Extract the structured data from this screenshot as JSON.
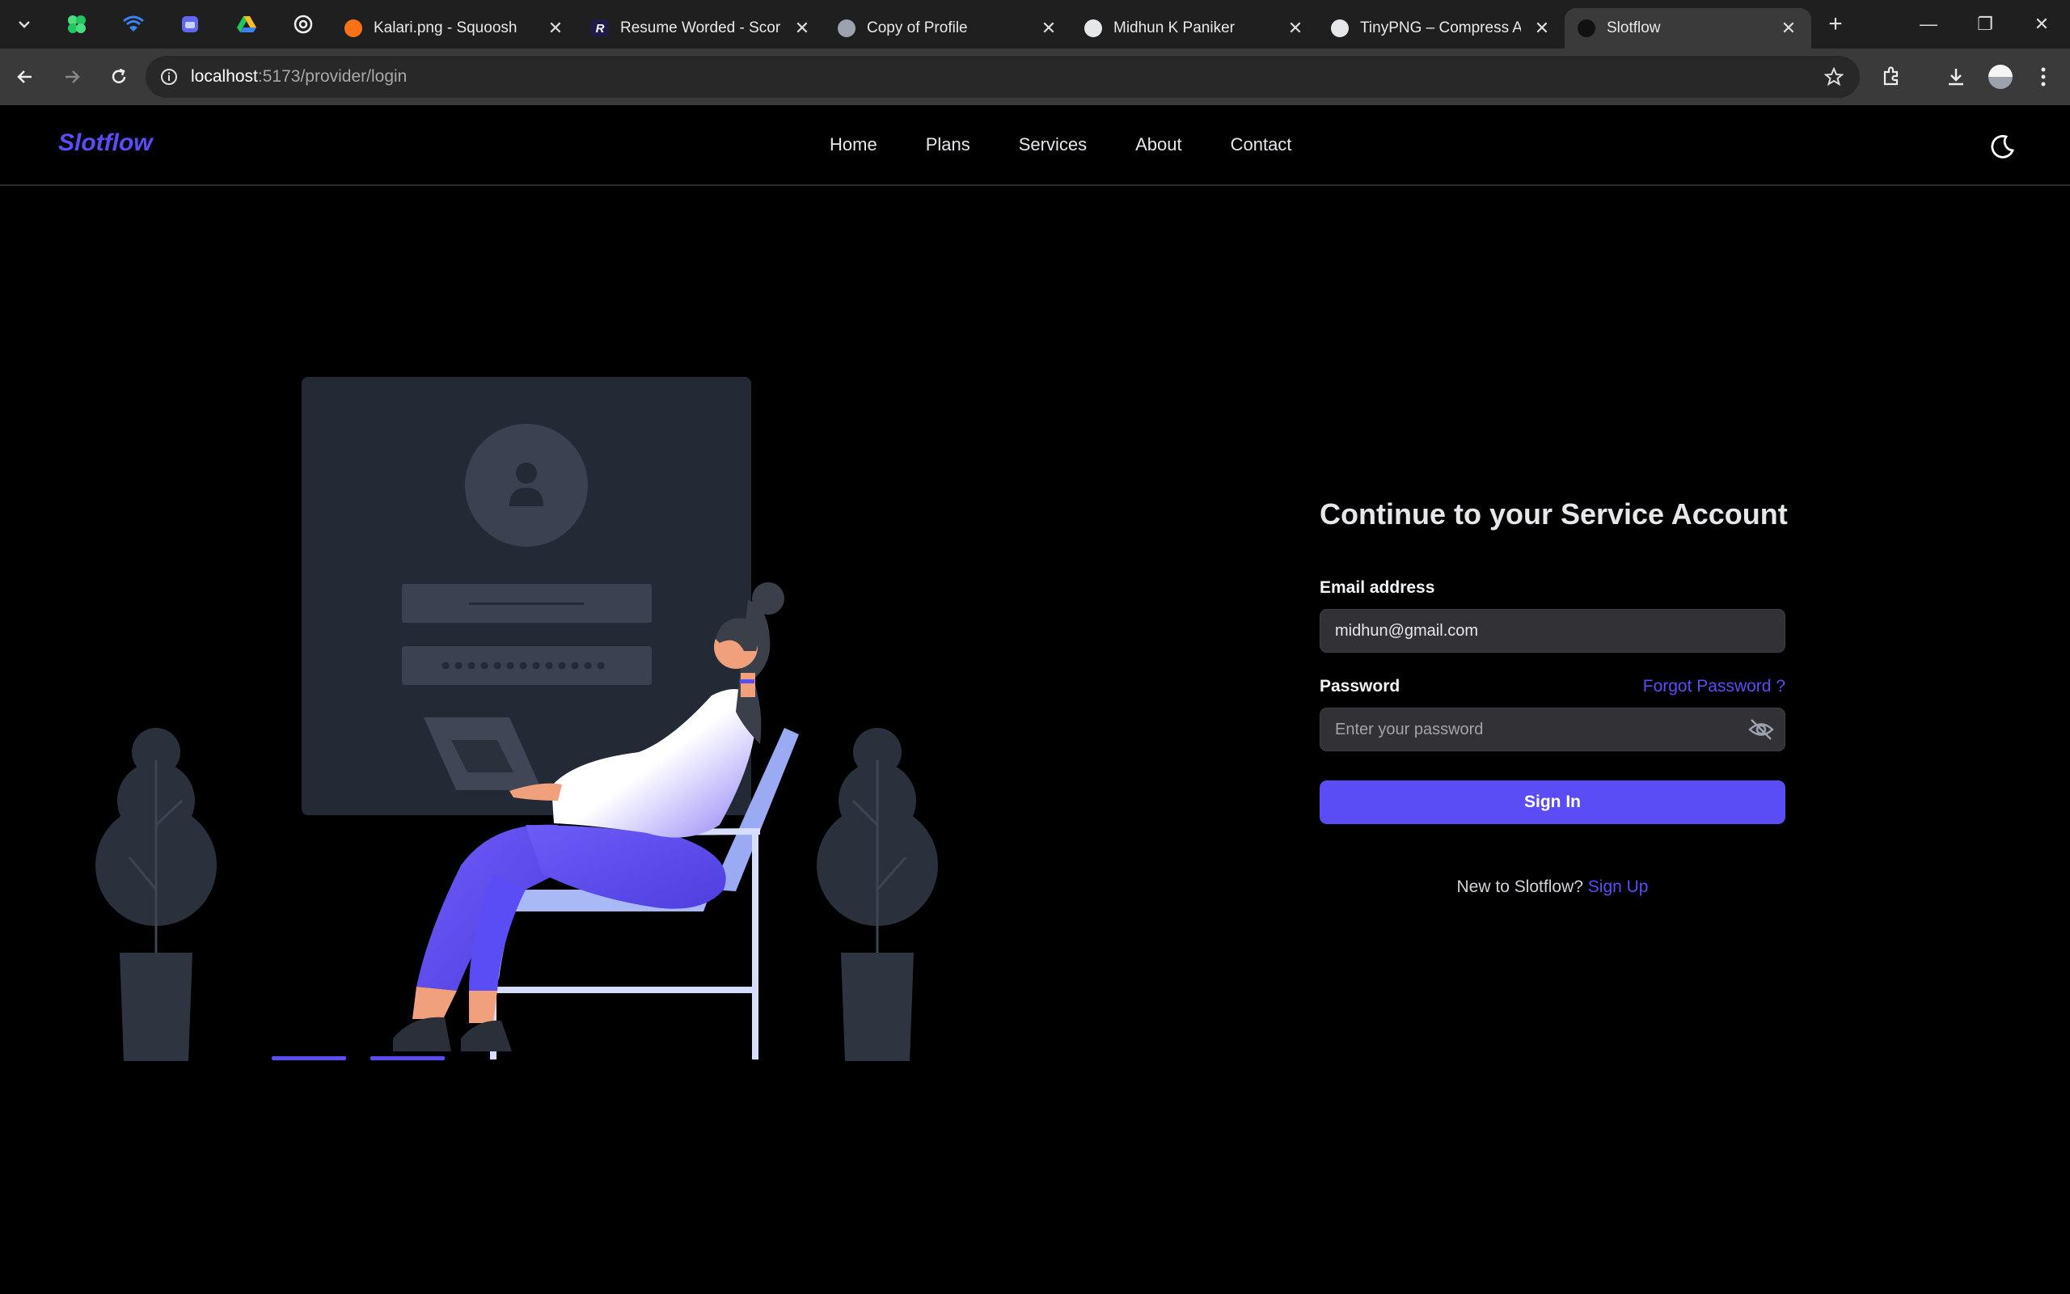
{
  "browser": {
    "tabs": [
      {
        "title": "Kalari.png - Squoosh",
        "icon": "squoosh-icon",
        "color": "#f97316",
        "active": false
      },
      {
        "title": "Resume Worded - Score",
        "icon": "resume-worded-icon",
        "color": "#1e1b4b",
        "active": false
      },
      {
        "title": "Copy of Profile",
        "icon": "globe-icon",
        "color": "#9ca3af",
        "active": false
      },
      {
        "title": "Midhun K Paniker",
        "icon": "profile-icon",
        "color": "#e5e7eb",
        "active": false
      },
      {
        "title": "TinyPNG – Compress AVIF",
        "icon": "tinypng-icon",
        "color": "#e5e7eb",
        "active": false
      },
      {
        "title": "Slotflow",
        "icon": "slotflow-icon",
        "color": "#111",
        "active": true
      }
    ],
    "url_host": "localhost",
    "url_rest": ":5173/provider/login"
  },
  "nav": {
    "brand": "Slotflow",
    "links": [
      "Home",
      "Plans",
      "Services",
      "About",
      "Contact"
    ]
  },
  "form": {
    "heading": "Continue to your Service Account",
    "email_label": "Email address",
    "email_value": "midhun@gmail.com",
    "password_label": "Password",
    "forgot": "Forgot Password ?",
    "password_placeholder": "Enter your password",
    "submit": "Sign In",
    "signup_prompt": "New to Slotflow?",
    "signup_link": "Sign Up"
  },
  "colors": {
    "accent": "#5b4df5",
    "background": "#000000"
  }
}
